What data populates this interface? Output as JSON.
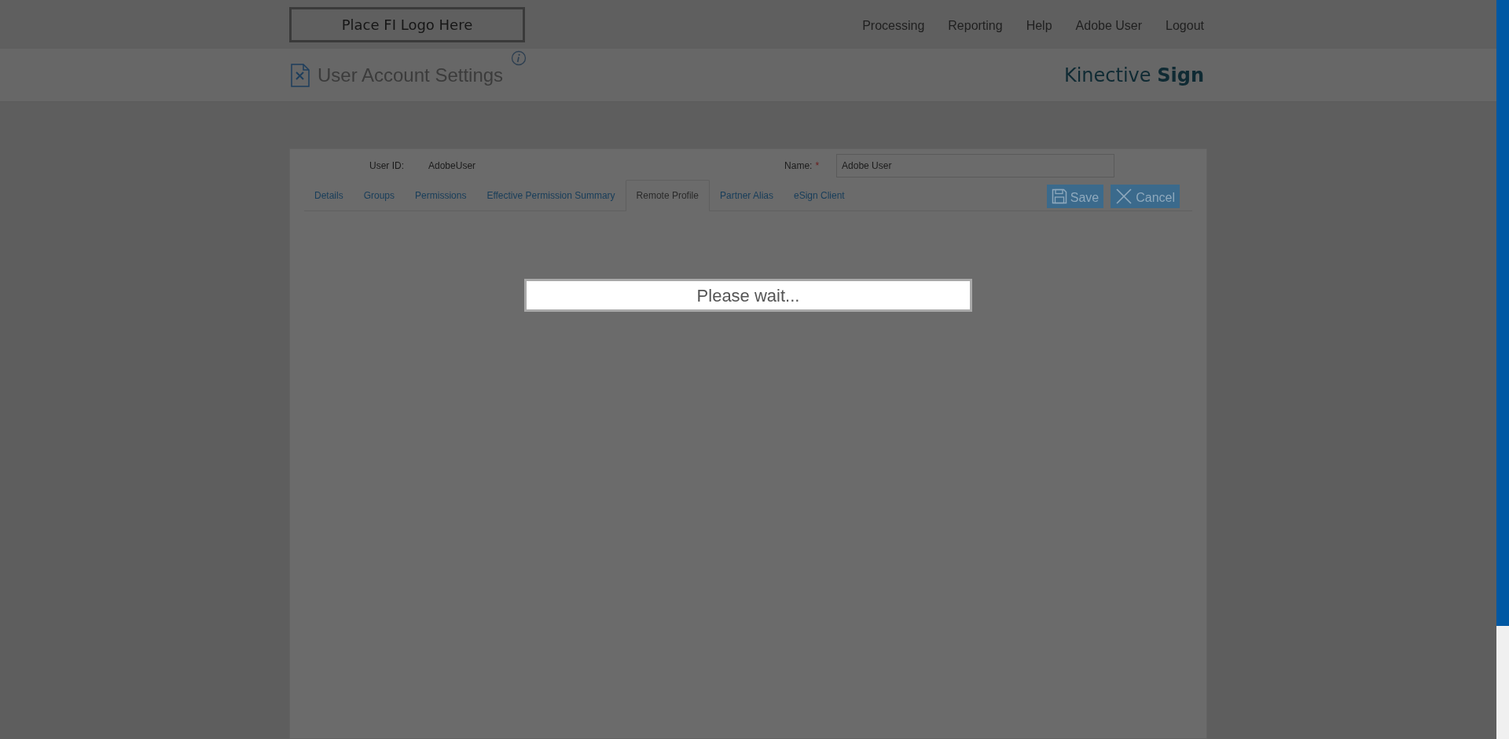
{
  "logo_placeholder": "Place FI Logo Here",
  "nav": [
    "Processing",
    "Reporting",
    "Help",
    "Adobe User",
    "Logout"
  ],
  "page_header": {
    "title": "User Account Settings",
    "brand": "Kinective **Sign**"
  },
  "form": {
    "user_id_label": "User ID:",
    "user_id_value": "AdobeUser",
    "name_label": "Name:",
    "name_required_mark": "*",
    "name_value": "Adobe User"
  },
  "tabs": [
    {
      "label": "Details",
      "selected": false
    },
    {
      "label": "Groups",
      "selected": false
    },
    {
      "label": "Permissions",
      "selected": false
    },
    {
      "label": "Effective Permission Summary",
      "selected": false
    },
    {
      "label": "Remote Profile",
      "selected": true
    },
    {
      "label": "Partner Alias",
      "selected": false
    },
    {
      "label": "eSign Client",
      "selected": false
    }
  ],
  "buttons": [
    {
      "kind": "save",
      "label": "Save"
    },
    {
      "kind": "cancel",
      "label": "Cancel"
    }
  ],
  "loading_message": "Please wait..."
}
